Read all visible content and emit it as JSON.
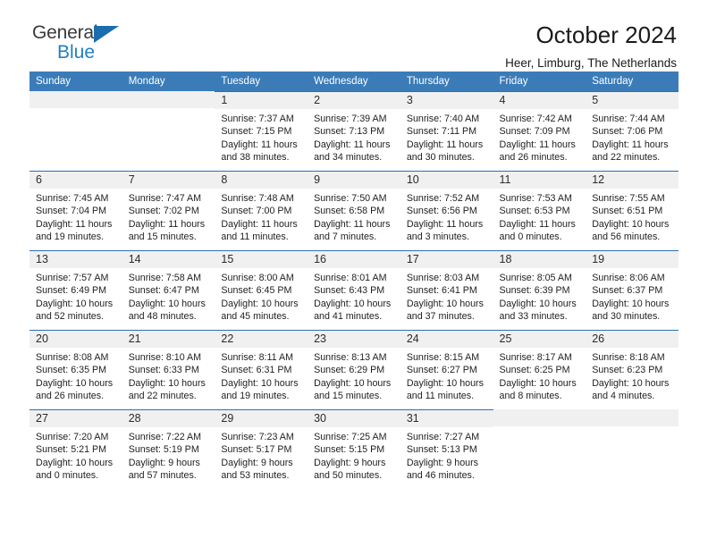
{
  "brand": {
    "name_top": "General",
    "name_bottom": "Blue",
    "triangle_icon": "triangle-icon",
    "color_dark": "#3a3a3a",
    "color_blue": "#1f7fc4"
  },
  "header": {
    "title": "October 2024",
    "subtitle": "Heer, Limburg, The Netherlands"
  },
  "theme": {
    "header_blue": "#3b7cb8",
    "cell_top_border": "#2f6fae",
    "daynum_band": "#f0f0f0"
  },
  "calendar": {
    "weekday_headers": [
      "Sunday",
      "Monday",
      "Tuesday",
      "Wednesday",
      "Thursday",
      "Friday",
      "Saturday"
    ],
    "weeks": [
      [
        {
          "day": ""
        },
        {
          "day": ""
        },
        {
          "day": "1",
          "sunrise": "Sunrise: 7:37 AM",
          "sunset": "Sunset: 7:15 PM",
          "daylight_1": "Daylight: 11 hours",
          "daylight_2": "and 38 minutes."
        },
        {
          "day": "2",
          "sunrise": "Sunrise: 7:39 AM",
          "sunset": "Sunset: 7:13 PM",
          "daylight_1": "Daylight: 11 hours",
          "daylight_2": "and 34 minutes."
        },
        {
          "day": "3",
          "sunrise": "Sunrise: 7:40 AM",
          "sunset": "Sunset: 7:11 PM",
          "daylight_1": "Daylight: 11 hours",
          "daylight_2": "and 30 minutes."
        },
        {
          "day": "4",
          "sunrise": "Sunrise: 7:42 AM",
          "sunset": "Sunset: 7:09 PM",
          "daylight_1": "Daylight: 11 hours",
          "daylight_2": "and 26 minutes."
        },
        {
          "day": "5",
          "sunrise": "Sunrise: 7:44 AM",
          "sunset": "Sunset: 7:06 PM",
          "daylight_1": "Daylight: 11 hours",
          "daylight_2": "and 22 minutes."
        }
      ],
      [
        {
          "day": "6",
          "sunrise": "Sunrise: 7:45 AM",
          "sunset": "Sunset: 7:04 PM",
          "daylight_1": "Daylight: 11 hours",
          "daylight_2": "and 19 minutes."
        },
        {
          "day": "7",
          "sunrise": "Sunrise: 7:47 AM",
          "sunset": "Sunset: 7:02 PM",
          "daylight_1": "Daylight: 11 hours",
          "daylight_2": "and 15 minutes."
        },
        {
          "day": "8",
          "sunrise": "Sunrise: 7:48 AM",
          "sunset": "Sunset: 7:00 PM",
          "daylight_1": "Daylight: 11 hours",
          "daylight_2": "and 11 minutes."
        },
        {
          "day": "9",
          "sunrise": "Sunrise: 7:50 AM",
          "sunset": "Sunset: 6:58 PM",
          "daylight_1": "Daylight: 11 hours",
          "daylight_2": "and 7 minutes."
        },
        {
          "day": "10",
          "sunrise": "Sunrise: 7:52 AM",
          "sunset": "Sunset: 6:56 PM",
          "daylight_1": "Daylight: 11 hours",
          "daylight_2": "and 3 minutes."
        },
        {
          "day": "11",
          "sunrise": "Sunrise: 7:53 AM",
          "sunset": "Sunset: 6:53 PM",
          "daylight_1": "Daylight: 11 hours",
          "daylight_2": "and 0 minutes."
        },
        {
          "day": "12",
          "sunrise": "Sunrise: 7:55 AM",
          "sunset": "Sunset: 6:51 PM",
          "daylight_1": "Daylight: 10 hours",
          "daylight_2": "and 56 minutes."
        }
      ],
      [
        {
          "day": "13",
          "sunrise": "Sunrise: 7:57 AM",
          "sunset": "Sunset: 6:49 PM",
          "daylight_1": "Daylight: 10 hours",
          "daylight_2": "and 52 minutes."
        },
        {
          "day": "14",
          "sunrise": "Sunrise: 7:58 AM",
          "sunset": "Sunset: 6:47 PM",
          "daylight_1": "Daylight: 10 hours",
          "daylight_2": "and 48 minutes."
        },
        {
          "day": "15",
          "sunrise": "Sunrise: 8:00 AM",
          "sunset": "Sunset: 6:45 PM",
          "daylight_1": "Daylight: 10 hours",
          "daylight_2": "and 45 minutes."
        },
        {
          "day": "16",
          "sunrise": "Sunrise: 8:01 AM",
          "sunset": "Sunset: 6:43 PM",
          "daylight_1": "Daylight: 10 hours",
          "daylight_2": "and 41 minutes."
        },
        {
          "day": "17",
          "sunrise": "Sunrise: 8:03 AM",
          "sunset": "Sunset: 6:41 PM",
          "daylight_1": "Daylight: 10 hours",
          "daylight_2": "and 37 minutes."
        },
        {
          "day": "18",
          "sunrise": "Sunrise: 8:05 AM",
          "sunset": "Sunset: 6:39 PM",
          "daylight_1": "Daylight: 10 hours",
          "daylight_2": "and 33 minutes."
        },
        {
          "day": "19",
          "sunrise": "Sunrise: 8:06 AM",
          "sunset": "Sunset: 6:37 PM",
          "daylight_1": "Daylight: 10 hours",
          "daylight_2": "and 30 minutes."
        }
      ],
      [
        {
          "day": "20",
          "sunrise": "Sunrise: 8:08 AM",
          "sunset": "Sunset: 6:35 PM",
          "daylight_1": "Daylight: 10 hours",
          "daylight_2": "and 26 minutes."
        },
        {
          "day": "21",
          "sunrise": "Sunrise: 8:10 AM",
          "sunset": "Sunset: 6:33 PM",
          "daylight_1": "Daylight: 10 hours",
          "daylight_2": "and 22 minutes."
        },
        {
          "day": "22",
          "sunrise": "Sunrise: 8:11 AM",
          "sunset": "Sunset: 6:31 PM",
          "daylight_1": "Daylight: 10 hours",
          "daylight_2": "and 19 minutes."
        },
        {
          "day": "23",
          "sunrise": "Sunrise: 8:13 AM",
          "sunset": "Sunset: 6:29 PM",
          "daylight_1": "Daylight: 10 hours",
          "daylight_2": "and 15 minutes."
        },
        {
          "day": "24",
          "sunrise": "Sunrise: 8:15 AM",
          "sunset": "Sunset: 6:27 PM",
          "daylight_1": "Daylight: 10 hours",
          "daylight_2": "and 11 minutes."
        },
        {
          "day": "25",
          "sunrise": "Sunrise: 8:17 AM",
          "sunset": "Sunset: 6:25 PM",
          "daylight_1": "Daylight: 10 hours",
          "daylight_2": "and 8 minutes."
        },
        {
          "day": "26",
          "sunrise": "Sunrise: 8:18 AM",
          "sunset": "Sunset: 6:23 PM",
          "daylight_1": "Daylight: 10 hours",
          "daylight_2": "and 4 minutes."
        }
      ],
      [
        {
          "day": "27",
          "sunrise": "Sunrise: 7:20 AM",
          "sunset": "Sunset: 5:21 PM",
          "daylight_1": "Daylight: 10 hours",
          "daylight_2": "and 0 minutes."
        },
        {
          "day": "28",
          "sunrise": "Sunrise: 7:22 AM",
          "sunset": "Sunset: 5:19 PM",
          "daylight_1": "Daylight: 9 hours",
          "daylight_2": "and 57 minutes."
        },
        {
          "day": "29",
          "sunrise": "Sunrise: 7:23 AM",
          "sunset": "Sunset: 5:17 PM",
          "daylight_1": "Daylight: 9 hours",
          "daylight_2": "and 53 minutes."
        },
        {
          "day": "30",
          "sunrise": "Sunrise: 7:25 AM",
          "sunset": "Sunset: 5:15 PM",
          "daylight_1": "Daylight: 9 hours",
          "daylight_2": "and 50 minutes."
        },
        {
          "day": "31",
          "sunrise": "Sunrise: 7:27 AM",
          "sunset": "Sunset: 5:13 PM",
          "daylight_1": "Daylight: 9 hours",
          "daylight_2": "and 46 minutes."
        },
        {
          "day": ""
        },
        {
          "day": ""
        }
      ]
    ]
  }
}
